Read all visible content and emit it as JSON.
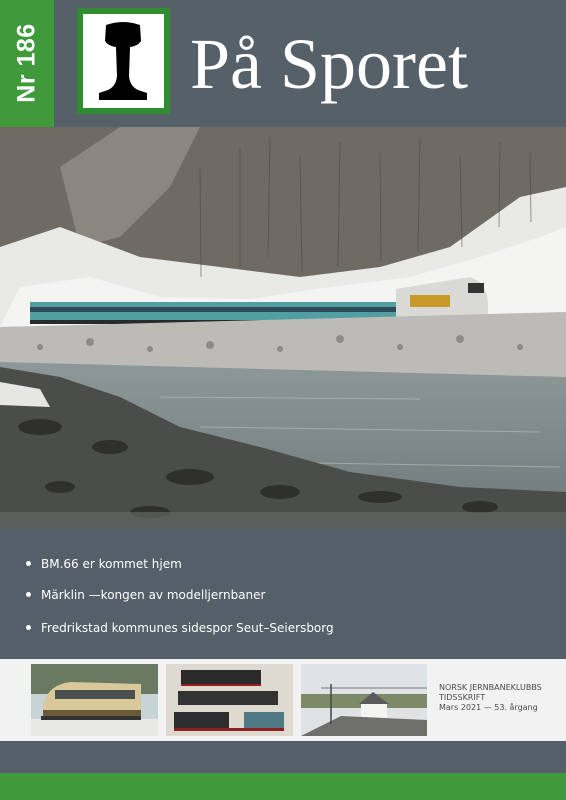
{
  "issue": {
    "label": "Nr 186"
  },
  "magazine": {
    "title": "På Sporet",
    "logo_icon": "rail-profile-icon"
  },
  "headlines": [
    "BM.66 er kommet hjem",
    "Märklin —kongen av modelljernbaner",
    "Fredrikstad kommunes sidespor Seut–Seiersborg"
  ],
  "publisher": {
    "line1": "NORSK JERNBANEKLUBBS",
    "line2": "TIDSSKRIFT",
    "line3": "Mars 2021 — 53. årgang"
  },
  "colors": {
    "green": "#3f9a3a",
    "slate": "#555f69",
    "logo_green": "#2f8c2f"
  }
}
